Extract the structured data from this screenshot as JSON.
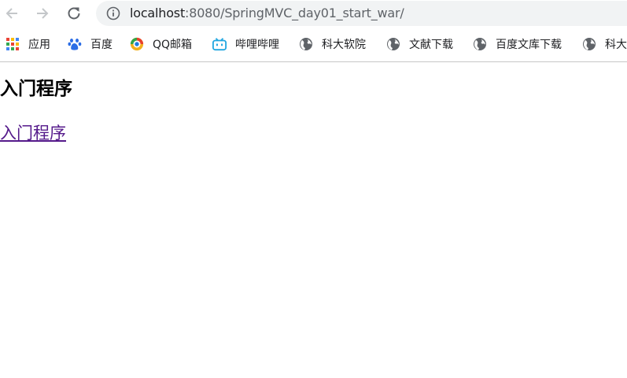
{
  "browser": {
    "url_host": "localhost",
    "url_path": ":8080/SpringMVC_day01_start_war/"
  },
  "bookmarks": [
    {
      "label": "应用",
      "icon": "apps-grid-icon"
    },
    {
      "label": "百度",
      "icon": "baidu-paw-icon"
    },
    {
      "label": "QQ邮箱",
      "icon": "qq-mail-icon"
    },
    {
      "label": "哔哩哔哩",
      "icon": "bilibili-tv-icon"
    },
    {
      "label": "科大软院",
      "icon": "globe-icon"
    },
    {
      "label": "文献下载",
      "icon": "globe-icon"
    },
    {
      "label": "百度文库下载",
      "icon": "globe-icon"
    },
    {
      "label": "科大",
      "icon": "globe-icon"
    }
  ],
  "page": {
    "heading": "入门程序",
    "link_text": "入门程序"
  },
  "colors": {
    "link_visited": "#551a8b",
    "omnibox_bg": "#f1f3f4"
  }
}
